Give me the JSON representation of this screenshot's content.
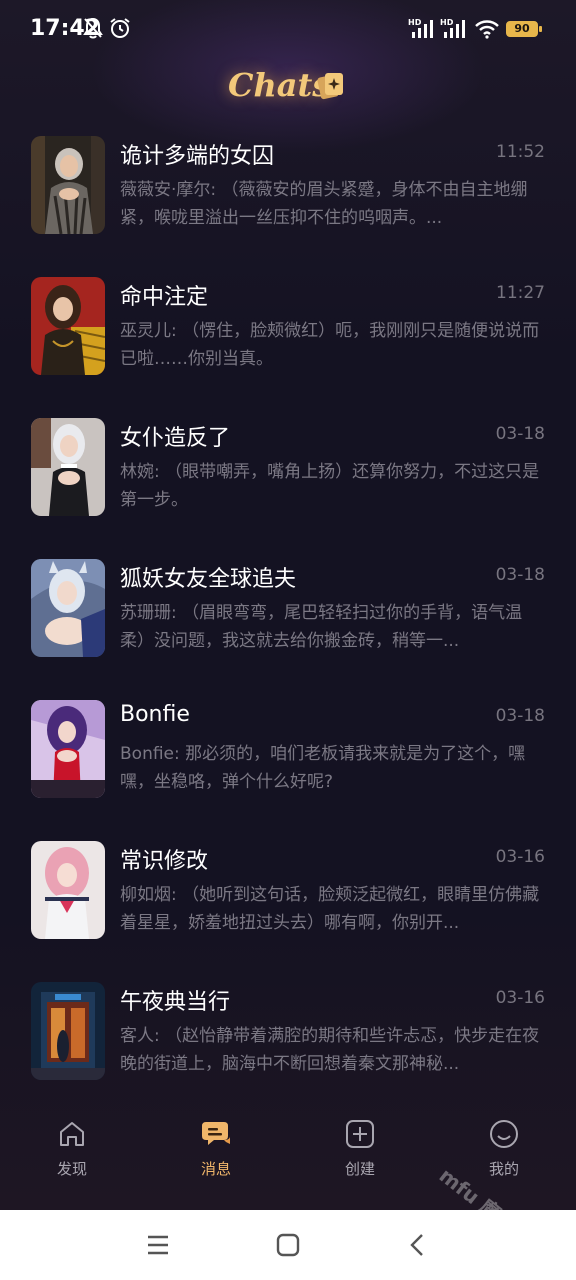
{
  "status_bar": {
    "time": "17:42",
    "signal_1": "HD",
    "signal_2": "HD",
    "battery": "90"
  },
  "header": {
    "title": "Chats"
  },
  "chats": [
    {
      "name": "诡计多端的女囚",
      "time": "11:52",
      "preview": "薇薇安·摩尔: （薇薇安的眉头紧蹙，身体不由自主地绷紧，喉咙里溢出一丝压抑不住的呜咽声。..."
    },
    {
      "name": "命中注定",
      "time": "11:27",
      "preview": "巫灵儿: （愣住，脸颊微红）呃，我刚刚只是随便说说而已啦……你别当真。"
    },
    {
      "name": "女仆造反了",
      "time": "03-18",
      "preview": "林婉: （眼带嘲弄，嘴角上扬）还算你努力，不过这只是第一步。"
    },
    {
      "name": "狐妖女友全球追夫",
      "time": "03-18",
      "preview": "苏珊珊: （眉眼弯弯，尾巴轻轻扫过你的手背，语气温柔）没问题，我这就去给你搬金砖，稍等一..."
    },
    {
      "name": "Bonfie",
      "time": "03-18",
      "preview": "Bonfie: 那必须的，咱们老板请我来就是为了这个，嘿嘿，坐稳咯，弹个什么好呢?"
    },
    {
      "name": "常识修改",
      "time": "03-16",
      "preview": "柳如烟: （她听到这句话，脸颊泛起微红，眼睛里仿佛藏着星星，娇羞地扭过头去）哪有啊，你别开..."
    },
    {
      "name": "午夜典当行",
      "time": "03-16",
      "preview": "客人: （赵怡静带着满腔的期待和些许忐忑，快步走在夜晚的街道上，脑海中不断回想着秦文那神秘..."
    }
  ],
  "nav": [
    {
      "label": "发现",
      "icon": "home-icon"
    },
    {
      "label": "消息",
      "icon": "chat-bubble-icon",
      "active": true
    },
    {
      "label": "创建",
      "icon": "plus-square-icon"
    },
    {
      "label": "我的",
      "icon": "smile-icon"
    }
  ],
  "watermark": "mfu 魔趣",
  "colors": {
    "accent": "#f0b66a",
    "title": "#f3c97a",
    "background": "#141222"
  }
}
